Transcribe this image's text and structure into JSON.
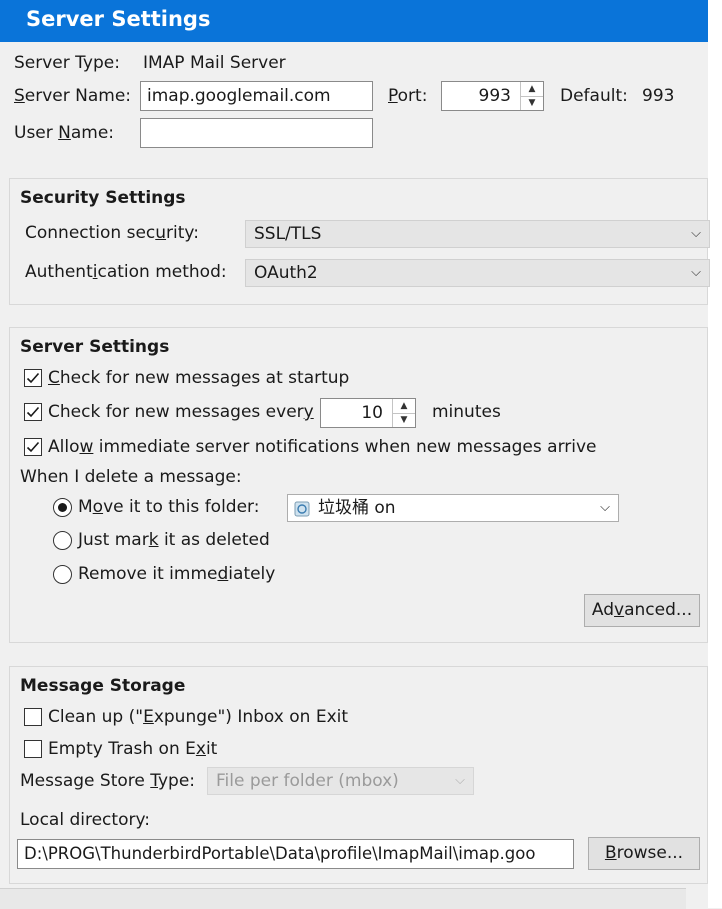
{
  "title": "Server Settings",
  "server_type": {
    "label": "Server Type:",
    "value": "IMAP Mail Server"
  },
  "server_name": {
    "label_pre": "",
    "label_ul": "S",
    "label_post": "erver Name:",
    "value": "imap.googlemail.com"
  },
  "port": {
    "label_pre": "",
    "label_ul": "P",
    "label_post": "ort:",
    "value": "993",
    "default_label": "Default:",
    "default_value": "993"
  },
  "user_name": {
    "label_pre": "User ",
    "label_ul": "N",
    "label_post": "ame:",
    "value": ""
  },
  "security": {
    "heading": "Security Settings",
    "connection_label_pre": "Connection sec",
    "connection_label_ul": "u",
    "connection_label_post": "rity:",
    "connection_value": "SSL/TLS",
    "auth_label_pre": "Authent",
    "auth_label_ul": "i",
    "auth_label_post": "cation method:",
    "auth_value": "OAuth2"
  },
  "server_settings": {
    "heading": "Server Settings",
    "check_startup": {
      "pre": "",
      "ul": "C",
      "post": "heck for new messages at startup",
      "checked": true
    },
    "check_every": {
      "pre": "Check for new messages ever",
      "ul": "y",
      "post": "",
      "checked": true,
      "minutes": "10",
      "unit": "minutes"
    },
    "allow_notifications": {
      "pre": "Allo",
      "ul": "w",
      "post": " immediate server notifications when new messages arrive",
      "checked": true
    },
    "delete_label": "When I delete a message:",
    "move_folder": {
      "pre": "M",
      "ul": "o",
      "post": "ve it to this folder:",
      "selected": true,
      "folder": "垃圾桶 on"
    },
    "just_mark": {
      "pre": "Just mar",
      "ul": "k",
      "post": " it as deleted",
      "selected": false
    },
    "remove": {
      "pre": "Remove it imme",
      "ul": "d",
      "post": "iately",
      "selected": false
    },
    "advanced_pre": "Ad",
    "advanced_ul": "v",
    "advanced_post": "anced..."
  },
  "storage": {
    "heading": "Message Storage",
    "cleanup": {
      "pre": "Clean up (\"",
      "ul": "E",
      "post": "xpunge\") Inbox on Exit",
      "checked": false
    },
    "empty_trash": {
      "pre": "Empty Trash on E",
      "ul": "x",
      "post": "it",
      "checked": false
    },
    "store_type_pre": "Message Store ",
    "store_type_ul": "T",
    "store_type_post": "ype:",
    "store_type_value": "File per folder (mbox)",
    "local_dir_label": "Local directory:",
    "local_dir_value": "D:\\PROG\\ThunderbirdPortable\\Data\\profile\\ImapMail\\imap.goo",
    "browse_pre": "",
    "browse_ul": "B",
    "browse_post": "rowse..."
  },
  "icons": {
    "chevron": "chevron-down-icon",
    "check": "checkmark-icon",
    "trash": "recycle-bin-icon"
  }
}
